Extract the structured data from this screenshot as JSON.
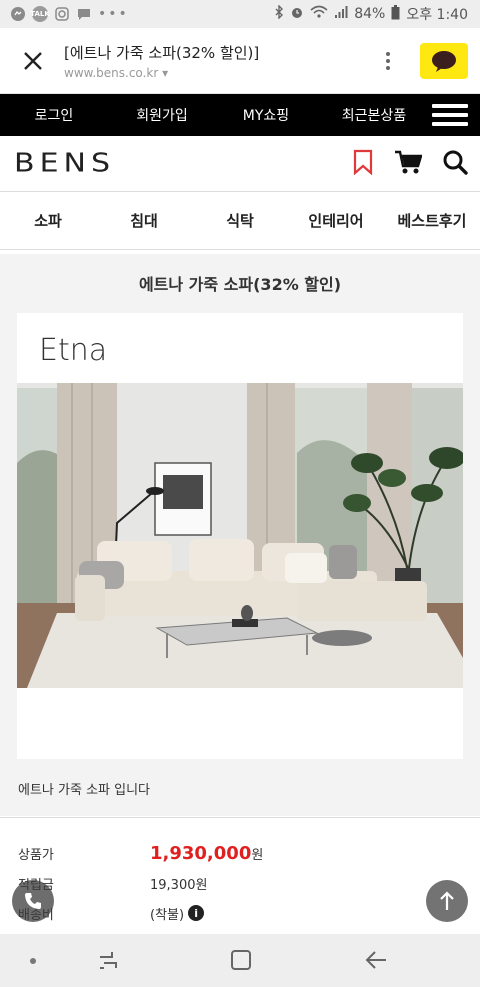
{
  "status_bar": {
    "battery": "84%",
    "time": "오후 1:40",
    "left_icons": [
      "messenger-icon",
      "talk-icon",
      "instagram-icon",
      "chat-icon",
      "more-dots-icon"
    ],
    "right_icons": [
      "bluetooth-icon",
      "alarm-icon",
      "wifi-icon",
      "signal-icon",
      "battery-icon"
    ]
  },
  "browser": {
    "title": "[에트나 가죽 소파(32% 할인)]",
    "url": "www.bens.co.kr",
    "kakao_color": "#ffe812"
  },
  "top_nav": {
    "items": [
      "로그인",
      "회원가입",
      "MY쇼핑",
      "최근본상품"
    ]
  },
  "logo": {
    "text": "BENS",
    "bookmark_color": "#e0393b"
  },
  "categories": [
    "소파",
    "침대",
    "식탁",
    "인테리어",
    "베스트후기"
  ],
  "product": {
    "title": "에트나 가죽 소파(32% 할인)",
    "image_caption": "Etna",
    "description": "에트나 가죽 소파 입니다"
  },
  "info": {
    "price_label": "상품가",
    "price_value": "1,930,000",
    "price_unit": "원",
    "price_color": "#e02020",
    "points_label": "적립금",
    "points_value": "19,300원",
    "shipping_label": "배송비",
    "shipping_value": "(착불)"
  }
}
